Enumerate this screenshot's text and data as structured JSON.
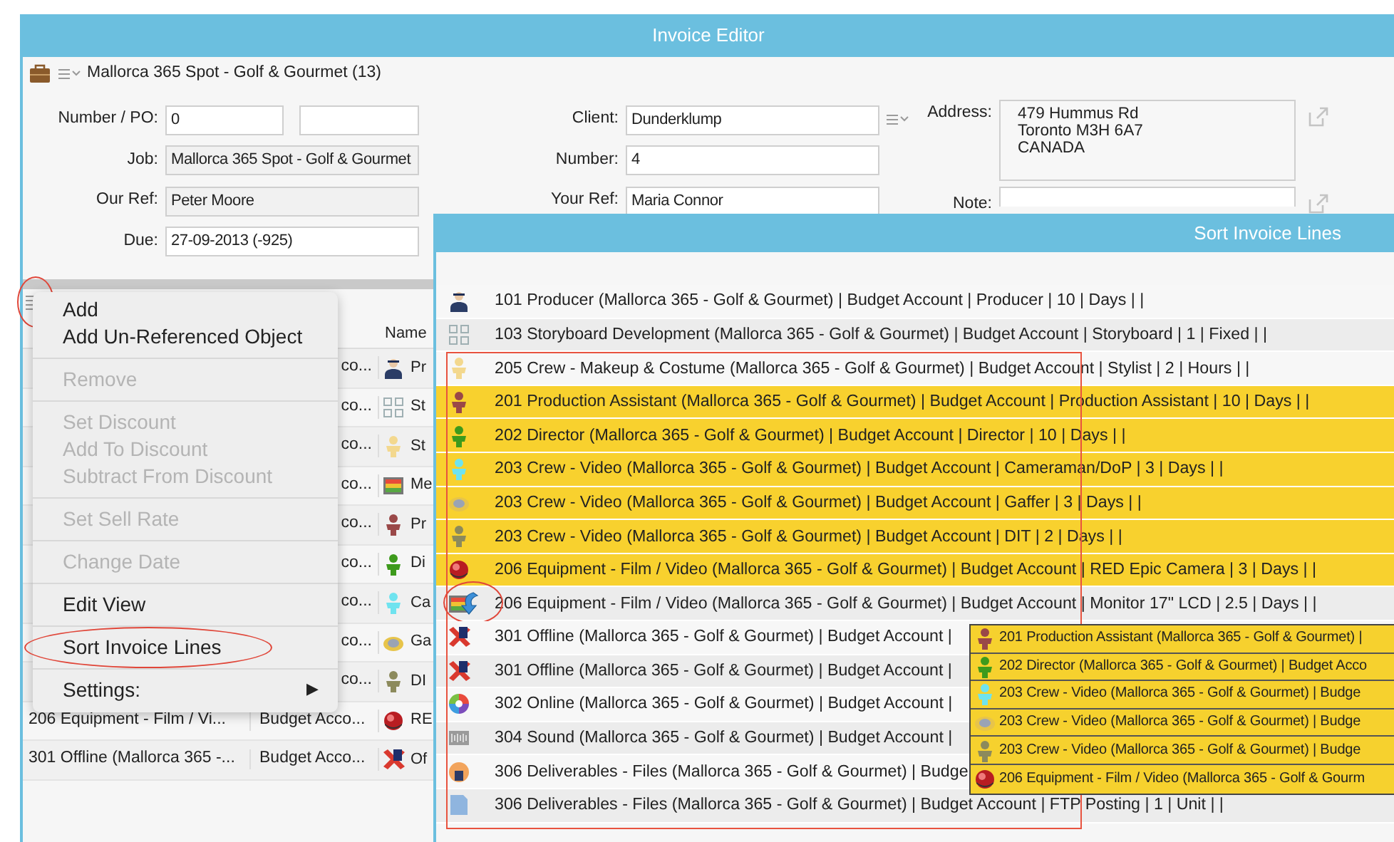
{
  "window": {
    "title": "Invoice Editor"
  },
  "header": {
    "title": "Mallorca 365 Spot - Golf & Gourmet (13)"
  },
  "form": {
    "left": [
      {
        "label": "Number / PO:",
        "value": "0",
        "kind": "double",
        "editable": true
      },
      {
        "label": "Job:",
        "value": "Mallorca 365 Spot - Golf & Gourmet",
        "kind": "text",
        "editable": false
      },
      {
        "label": "Our Ref:",
        "value": "Peter Moore",
        "kind": "text",
        "editable": false
      },
      {
        "label": "Due:",
        "value": "27-09-2013 (-925)",
        "kind": "text",
        "editable": true
      }
    ],
    "middle": [
      {
        "label": "Client:",
        "value": "Dunderklump",
        "kind": "menu",
        "editable": true
      },
      {
        "label": "Number:",
        "value": "4",
        "kind": "text",
        "editable": true
      },
      {
        "label": "Your Ref:",
        "value": "Maria Connor",
        "kind": "text",
        "editable": true
      }
    ],
    "right": [
      {
        "label": "Address:",
        "lines": [
          "479 Hummus Rd",
          "Toronto M3H 6A7",
          "CANADA"
        ]
      },
      {
        "label": "Note:"
      }
    ]
  },
  "table": {
    "menu_circled": true,
    "name_header": "Name",
    "rows": [
      {
        "column_2": "co...",
        "kind": "producer",
        "name": "Pr"
      },
      {
        "column_2": "co...",
        "kind": "storyboard",
        "name": "St"
      },
      {
        "column_2": "co...",
        "kind": "person",
        "color": "#f3d88e",
        "name": "St"
      },
      {
        "column_2": "co...",
        "kind": "monitor",
        "name": "Me"
      },
      {
        "column_2": "co...",
        "kind": "person",
        "color": "#9a4848",
        "name": "Pr"
      },
      {
        "column_2": "co...",
        "kind": "person",
        "color": "#3d9a1c",
        "name": "Di"
      },
      {
        "column_2": "co...",
        "kind": "person",
        "color": "#6fe3ef",
        "name": "Ca"
      },
      {
        "column_2": "co...",
        "kind": "gaffer",
        "name": "Ga"
      },
      {
        "column_2": "co...",
        "kind": "person",
        "color": "#8c8a5c",
        "name": "DI"
      },
      {
        "column_1": "206 Equipment - Film / Vi...",
        "column_2": "Budget Acco...",
        "kind": "ball",
        "name": "RE"
      },
      {
        "column_1": "301 Offline (Mallorca 365 -...",
        "column_2": "Budget Acco...",
        "kind": "offline",
        "name": "Of"
      }
    ]
  },
  "context_menu": {
    "items": [
      {
        "kind": "item",
        "label": "Add",
        "disabled": false,
        "circled": false
      },
      {
        "kind": "item",
        "label": "Add Un-Referenced Object",
        "disabled": false,
        "circled": false
      },
      {
        "kind": "separator"
      },
      {
        "kind": "item",
        "label": "Remove",
        "disabled": true,
        "circled": false
      },
      {
        "kind": "separator"
      },
      {
        "kind": "item",
        "label": "Set Discount",
        "disabled": true,
        "circled": false
      },
      {
        "kind": "item",
        "label": "Add To Discount",
        "disabled": true,
        "circled": false
      },
      {
        "kind": "item",
        "label": "Subtract From Discount",
        "disabled": true,
        "circled": false
      },
      {
        "kind": "separator"
      },
      {
        "kind": "item",
        "label": "Set Sell Rate",
        "disabled": true,
        "circled": false
      },
      {
        "kind": "separator"
      },
      {
        "kind": "item",
        "label": "Change Date",
        "disabled": true,
        "circled": false
      },
      {
        "kind": "separator"
      },
      {
        "kind": "item",
        "label": "Edit View",
        "disabled": false,
        "circled": false
      },
      {
        "kind": "separator"
      },
      {
        "kind": "item",
        "label": "Sort Invoice Lines",
        "disabled": false,
        "circled": true
      },
      {
        "kind": "separator"
      },
      {
        "kind": "submenu",
        "label": "Settings:",
        "arrow": "▶",
        "disabled": false,
        "circled": false
      }
    ]
  },
  "sort_dialog": {
    "title": "Sort Invoice Lines",
    "rows": [
      {
        "text": "101 Producer (Mallorca 365 - Golf & Gourmet) | Budget Account | Producer | 10 | Days | |",
        "kind": "producer",
        "selected": false,
        "boxed": false,
        "circled": false
      },
      {
        "text": "103 Storyboard Development (Mallorca 365 - Golf & Gourmet) | Budget Account | Storyboard | 1 | Fixed | |",
        "kind": "storyboard",
        "selected": false,
        "boxed": false,
        "circled": false
      },
      {
        "text": "205 Crew - Makeup & Costume (Mallorca 365 - Golf & Gourmet) | Budget Account | Stylist | 2 | Hours | |",
        "kind": "person",
        "color": "#f3d88e",
        "selected": false,
        "boxed": true,
        "circled": false
      },
      {
        "text": "201 Production Assistant (Mallorca 365 - Golf & Gourmet) | Budget Account | Production Assistant | 10 | Days | |",
        "kind": "person",
        "color": "#9a4848",
        "selected": true,
        "boxed": true,
        "circled": false
      },
      {
        "text": "202 Director (Mallorca 365 - Golf & Gourmet) | Budget Account | Director | 10 | Days | |",
        "kind": "person",
        "color": "#3d9a1c",
        "selected": true,
        "boxed": true,
        "circled": false
      },
      {
        "text": "203 Crew - Video (Mallorca 365 - Golf & Gourmet) | Budget Account | Cameraman/DoP | 3 | Days | |",
        "kind": "person",
        "color": "#6fe3ef",
        "selected": true,
        "boxed": true,
        "circled": false
      },
      {
        "text": "203 Crew - Video (Mallorca 365 - Golf & Gourmet) | Budget Account | Gaffer | 3 | Days | |",
        "kind": "gaffer",
        "selected": true,
        "boxed": true,
        "circled": false
      },
      {
        "text": "203 Crew - Video (Mallorca 365 - Golf & Gourmet) | Budget Account | DIT | 2 | Days | |",
        "kind": "person",
        "color": "#8c8a5c",
        "selected": true,
        "boxed": true,
        "circled": false
      },
      {
        "text": "206 Equipment - Film / Video (Mallorca 365 - Golf & Gourmet) | Budget Account | RED Epic Camera | 3 | Days | |",
        "kind": "ball",
        "selected": true,
        "boxed": true,
        "circled": false
      },
      {
        "text": "206 Equipment - Film / Video (Mallorca 365 - Golf & Gourmet) | Budget Account | Monitor 17\" LCD | 2.5 | Days | |",
        "kind": "monitor",
        "selected": false,
        "boxed": true,
        "circled": true
      },
      {
        "text": "301 Offline (Mallorca 365 - Golf & Gourmet) | Budget Account |",
        "kind": "offline",
        "selected": false,
        "boxed": true,
        "circled": false
      },
      {
        "text": "301 Offline (Mallorca 365 - Golf & Gourmet) | Budget Account |",
        "kind": "offline",
        "selected": false,
        "boxed": true,
        "circled": false
      },
      {
        "text": "302 Online (Mallorca 365 - Golf & Gourmet) | Budget Account |",
        "kind": "colorwheel",
        "selected": false,
        "boxed": true,
        "circled": false
      },
      {
        "text": "304 Sound (Mallorca 365 - Golf & Gourmet) | Budget Account |",
        "kind": "sound",
        "selected": false,
        "boxed": true,
        "circled": false
      },
      {
        "text": "306 Deliverables - Files (Mallorca 365 - Golf & Gourmet) | Budge",
        "kind": "deliverable",
        "selected": false,
        "boxed": true,
        "circled": false
      },
      {
        "text": "306 Deliverables - Files (Mallorca 365 - Golf & Gourmet) | Budget Account | FTP Posting | 1 | Unit | |",
        "kind": "file",
        "selected": false,
        "boxed": true,
        "circled": false
      }
    ],
    "drag_preview": [
      {
        "text": "201 Production Assistant (Mallorca 365 - Golf & Gourmet) |",
        "kind": "person",
        "color": "#9a4848"
      },
      {
        "text": "202 Director (Mallorca 365 - Golf & Gourmet) | Budget Acco",
        "kind": "person",
        "color": "#3d9a1c"
      },
      {
        "text": "203 Crew - Video (Mallorca 365 - Golf & Gourmet) | Budge",
        "kind": "person",
        "color": "#6fe3ef"
      },
      {
        "text": "203 Crew - Video (Mallorca 365 - Golf & Gourmet) | Budge",
        "kind": "gaffer"
      },
      {
        "text": "203 Crew - Video (Mallorca 365 - Golf & Gourmet) | Budge",
        "kind": "person",
        "color": "#8c8a5c"
      },
      {
        "text": "206 Equipment - Film / Video (Mallorca 365 - Golf & Gourm",
        "kind": "ball"
      }
    ]
  }
}
